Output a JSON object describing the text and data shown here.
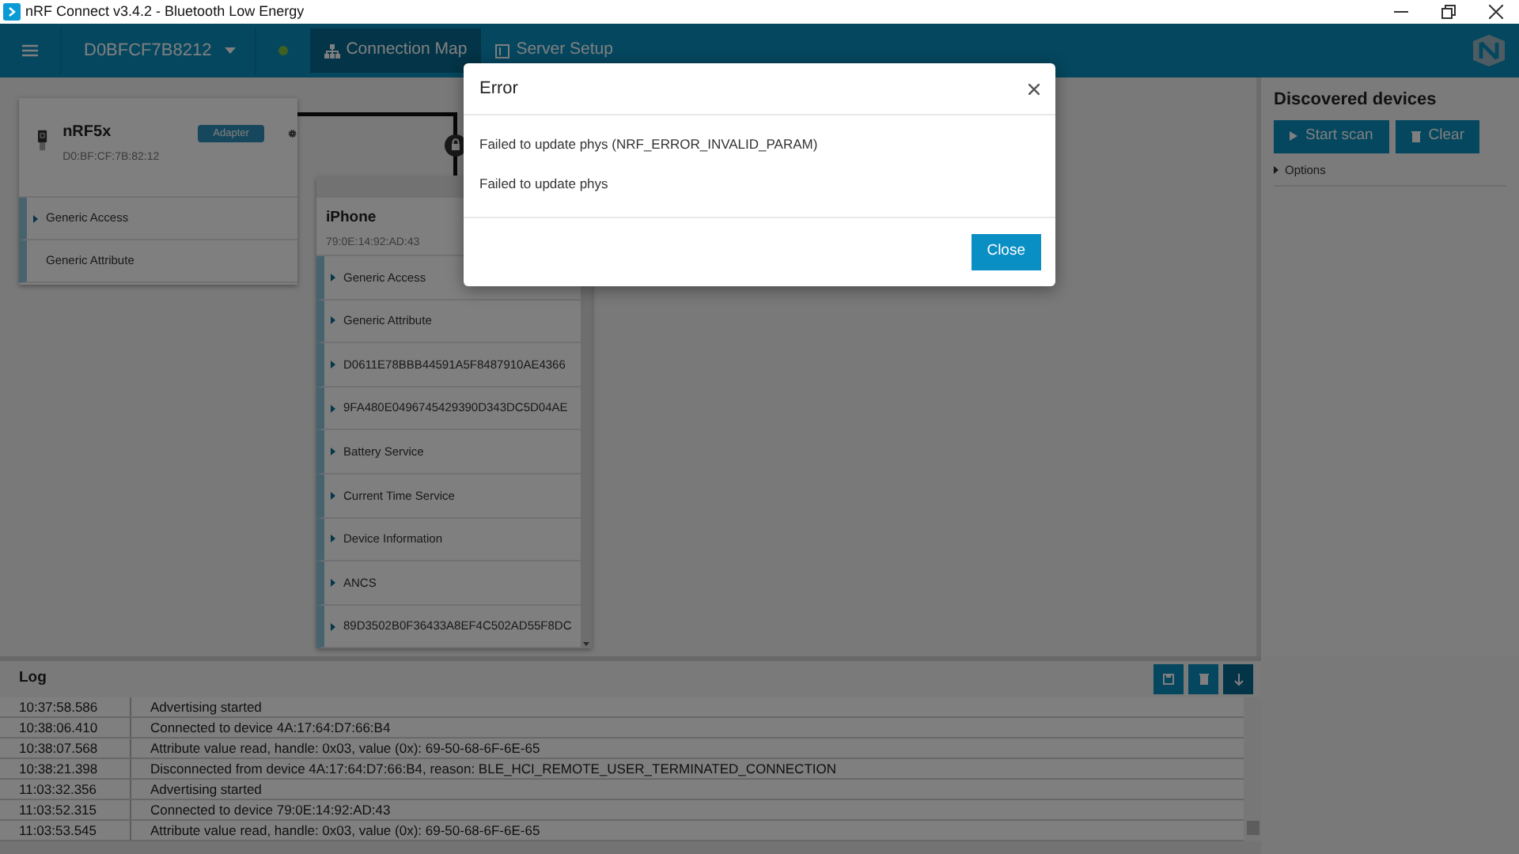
{
  "window": {
    "title": "nRF Connect v3.4.2 - Bluetooth Low Energy"
  },
  "navbar": {
    "device_selector": "D0BFCF7B8212",
    "connected": true,
    "tabs": [
      {
        "label": "Connection Map",
        "selected": true
      },
      {
        "label": "Server Setup",
        "selected": false
      }
    ]
  },
  "adapter": {
    "name": "nRF5x",
    "badge": "Adapter",
    "address": "D0:BF:CF:7B:82:12",
    "services": [
      {
        "name": "Generic Access",
        "expandable": true
      },
      {
        "name": "Generic Attribute",
        "expandable": false
      }
    ]
  },
  "peripheral": {
    "name": "iPhone",
    "address": "79:0E:14:92:AD:43",
    "locked": true,
    "services": [
      {
        "name": "Generic Access",
        "expandable": true
      },
      {
        "name": "Generic Attribute",
        "expandable": true
      },
      {
        "name": "D0611E78BBB44591A5F8487910AE4366",
        "expandable": true
      },
      {
        "name": "9FA480E0496745429390D343DC5D04AE",
        "expandable": true
      },
      {
        "name": "Battery Service",
        "expandable": true
      },
      {
        "name": "Current Time Service",
        "expandable": true
      },
      {
        "name": "Device Information",
        "expandable": true
      },
      {
        "name": "ANCS",
        "expandable": true
      },
      {
        "name": "89D3502B0F36433A8EF4C502AD55F8DC",
        "expandable": true
      }
    ]
  },
  "sidebar": {
    "title": "Discovered devices",
    "buttons": [
      {
        "label": "Start scan",
        "kind": "scan"
      },
      {
        "label": "Clear",
        "kind": "clear"
      }
    ],
    "options": "Options"
  },
  "log": {
    "title": "Log",
    "entries": [
      {
        "time": "10:37:58.586",
        "message": "Advertising started"
      },
      {
        "time": "10:38:06.410",
        "message": "Connected to device 4A:17:64:D7:66:B4"
      },
      {
        "time": "10:38:07.568",
        "message": "Attribute value read, handle: 0x03, value (0x): 69-50-68-6F-6E-65"
      },
      {
        "time": "10:38:21.398",
        "message": "Disconnected from device 4A:17:64:D7:66:B4, reason: BLE_HCI_REMOTE_USER_TERMINATED_CONNECTION"
      },
      {
        "time": "11:03:32.356",
        "message": "Advertising started"
      },
      {
        "time": "11:03:52.315",
        "message": "Connected to device 79:0E:14:92:AD:43"
      },
      {
        "time": "11:03:53.545",
        "message": "Attribute value read, handle: 0x03, value (0x): 69-50-68-6F-6E-65"
      }
    ]
  },
  "dialog": {
    "title": "Error",
    "messages": [
      "Failed to update phys (NRF_ERROR_INVALID_PARAM)",
      "Failed to update phys"
    ],
    "button": "Close"
  }
}
